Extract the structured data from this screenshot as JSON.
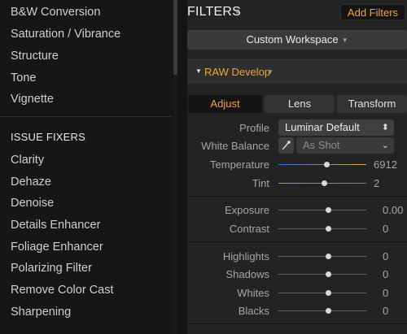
{
  "left_panel": {
    "top_items": [
      "B&W Conversion",
      "Saturation / Vibrance",
      "Structure",
      "Tone",
      "Vignette"
    ],
    "section_title": "ISSUE FIXERS",
    "issue_fixers": [
      "Clarity",
      "Dehaze",
      "Denoise",
      "Details Enhancer",
      "Foliage Enhancer",
      "Polarizing Filter",
      "Remove Color Cast",
      "Sharpening"
    ]
  },
  "header": {
    "title": "FILTERS",
    "title_icon": "chevron-down-icon",
    "add_button": "Add Filters",
    "accent_color": "#f0a43a"
  },
  "workspace": {
    "label": "Custom Workspace",
    "icon": "chevron-down-icon"
  },
  "raw_develop": {
    "title": "RAW Develop",
    "expand_icon": "triangle-down-icon",
    "menu_icon": "chevron-down-icon"
  },
  "tabs": {
    "adjust": "Adjust",
    "lens": "Lens",
    "transform": "Transform",
    "active": "Adjust"
  },
  "profile": {
    "label": "Profile",
    "value": "Luminar Default"
  },
  "white_balance": {
    "label": "White Balance",
    "value": "As Shot",
    "tool_icon": "eyedropper-icon"
  },
  "sliders": {
    "temperature": {
      "label": "Temperature",
      "value": "6912",
      "position": 0.55
    },
    "tint": {
      "label": "Tint",
      "value": "2",
      "position": 0.52
    },
    "exposure": {
      "label": "Exposure",
      "value": "0.00",
      "position": 0.57
    },
    "contrast": {
      "label": "Contrast",
      "value": "0",
      "position": 0.57
    },
    "highlights": {
      "label": "Highlights",
      "value": "0",
      "position": 0.57
    },
    "shadows": {
      "label": "Shadows",
      "value": "0",
      "position": 0.57
    },
    "whites": {
      "label": "Whites",
      "value": "0",
      "position": 0.57
    },
    "blacks": {
      "label": "Blacks",
      "value": "0",
      "position": 0.57
    }
  }
}
